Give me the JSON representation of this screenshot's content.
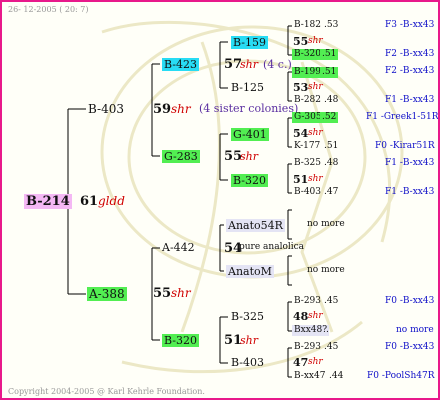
{
  "header_date": "26- 12-2005 ( 20: 7)",
  "footer": "Copyright 2004-2005 @ Karl Kehrle Foundation.",
  "root": {
    "id": "B-214",
    "num": "61",
    "suffix": "gldd"
  },
  "upper": {
    "father": {
      "id": "B-403"
    },
    "mating": {
      "num": "59",
      "suffix": "shr",
      "note": "(4 sister colonies)"
    },
    "a": {
      "id": "B-423",
      "mating": {
        "num": "57",
        "suffix": "shr",
        "note": "(4 c.)"
      },
      "f": {
        "id": "B-159",
        "num": "55",
        "suffix": "shr",
        "ff": {
          "id": "B-182",
          "v": ".53",
          "orig": "F3 -B-xx43"
        },
        "fm": {
          "id": "B-320",
          "v": ".51",
          "orig": "F2 -B-xx43"
        }
      },
      "m": {
        "id": "B-125",
        "num": "53",
        "suffix": "shr",
        "mf": {
          "id": "B-199",
          "v": ".51",
          "orig": "F2 -B-xx43"
        },
        "mm": {
          "id": "B-282",
          "v": ".48",
          "orig": "F1 -B-xx43"
        }
      }
    },
    "b": {
      "id": "G-283",
      "mating": {
        "num": "55",
        "suffix": "shr"
      },
      "f": {
        "id": "G-401",
        "num": "54",
        "suffix": "shr",
        "ff": {
          "id": "G-305",
          "v": ".52",
          "orig": "F1 -Greek1-51R"
        },
        "fm": {
          "id": "K-177",
          "v": ".51",
          "orig": "F0 -Kirar51R"
        }
      },
      "m": {
        "id": "B-320",
        "num": "51",
        "suffix": "shr",
        "mf": {
          "id": "B-325",
          "v": ".48",
          "orig": "F1 -B-xx43"
        },
        "mm": {
          "id": "B-403",
          "v": ".47",
          "orig": "F1 -B-xx43"
        }
      }
    }
  },
  "lower": {
    "mother": {
      "id": "A-388"
    },
    "mating": {
      "num": "55",
      "suffix": "shr"
    },
    "a": {
      "id": "A-442",
      "mating": {
        "num": "54",
        "text": "pure analolica"
      },
      "f": {
        "id": "Anato54R",
        "more": "no more"
      },
      "m": {
        "id": "AnatoM",
        "more": "no more"
      }
    },
    "b": {
      "id": "B-320",
      "mating": {
        "num": "51",
        "suffix": "shr"
      },
      "f": {
        "id": "B-325",
        "num": "48",
        "suffix": "shr",
        "ff": {
          "id": "B-293",
          "v": ".45",
          "orig": "F0 -B-xx43"
        },
        "fm": {
          "id": "Bxx48?",
          "v": ".",
          "orig": "no more"
        }
      },
      "m": {
        "id": "B-403",
        "num": "47",
        "suffix": "shr",
        "mf": {
          "id": "B-293",
          "v": ".45",
          "orig": "F0 -B-xx43"
        },
        "mm": {
          "id": "B-xx47",
          "v": ".44",
          "orig": "F0 -PoolSh47R"
        }
      }
    }
  }
}
